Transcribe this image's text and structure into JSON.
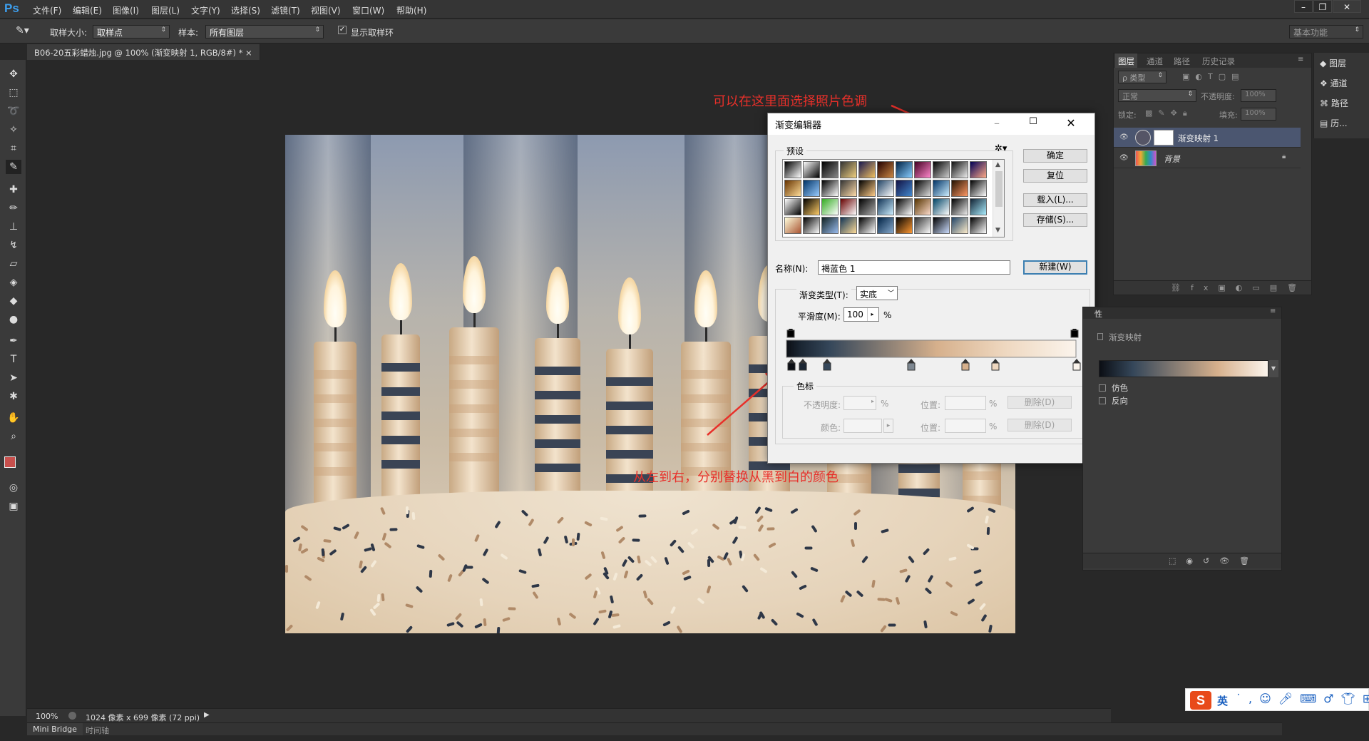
{
  "menubar": {
    "logo": "Ps",
    "items": [
      "文件(F)",
      "编辑(E)",
      "图像(I)",
      "图层(L)",
      "文字(Y)",
      "选择(S)",
      "滤镜(T)",
      "视图(V)",
      "窗口(W)",
      "帮助(H)"
    ]
  },
  "options": {
    "sample_size_label": "取样大小:",
    "sample_size_value": "取样点",
    "sample_label": "样本:",
    "sample_value": "所有图层",
    "show_ring_label": "显示取样环",
    "workspace": "基本功能"
  },
  "doc_tab": {
    "title": "B06-20五彩蜡烛.jpg @ 100% (渐变映射 1, RGB/8#) *"
  },
  "status": {
    "zoom": "100%",
    "info": "1024 像素 x 699 像素 (72 ppi)"
  },
  "bottom_tabs": [
    "Mini Bridge",
    "时间轴"
  ],
  "layers_panel": {
    "tabs": [
      "图层",
      "通道",
      "路径",
      "历史记录"
    ],
    "filter": "ρ 类型",
    "blend_mode": "正常",
    "opacity_label": "不透明度:",
    "opacity_value": "100%",
    "lock_label": "锁定:",
    "fill_label": "填充:",
    "fill_value": "100%",
    "layers": [
      {
        "name": "渐变映射 1"
      },
      {
        "name": "背景"
      }
    ]
  },
  "dock": [
    "图层",
    "通道",
    "路径",
    "历..."
  ],
  "properties": {
    "title": "性",
    "subtitle": "渐变映射",
    "dither": "仿色",
    "reverse": "反向"
  },
  "dialog": {
    "title": "渐变编辑器",
    "presets_label": "预设",
    "ok": "确定",
    "reset": "复位",
    "load": "载入(L)...",
    "save": "存储(S)...",
    "name_label": "名称(N):",
    "name_value": "褐蓝色 1",
    "new": "新建(W)",
    "type_label": "渐变类型(T):",
    "type_value": "实底",
    "smooth_label": "平滑度(M):",
    "smooth_value": "100",
    "percent": "%",
    "stops_label": "色标",
    "opacity_label": "不透明度:",
    "position_label": "位置:",
    "delete_label": "删除(D)",
    "color_label": "颜色:",
    "gradient_colors": [
      "#0b0e14",
      "#1b2633",
      "#35475a",
      "#d6b08c",
      "#eed7bf",
      "#fbf4ec"
    ]
  },
  "annotations": {
    "top": "可以在这里面选择照片色调",
    "bottom": "从左到右，分别替换从黑到白的颜色"
  },
  "ime": {
    "label": "英"
  }
}
